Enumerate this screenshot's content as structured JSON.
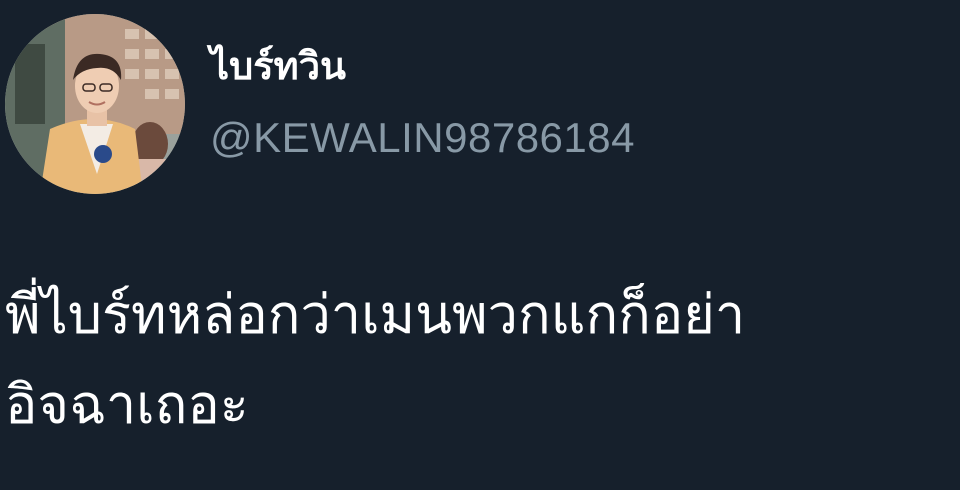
{
  "author": {
    "display_name": "ไบร์ทวิน",
    "handle": "@KEWALIN98786184"
  },
  "tweet": {
    "line1": "พี่ไบร์ทหล่อกว่าเมนพวกแกก็อย่า",
    "line2": "อิจฉาเถอะ"
  },
  "colors": {
    "background": "#16202c",
    "text": "#ffffff",
    "handle": "#8899a6"
  }
}
